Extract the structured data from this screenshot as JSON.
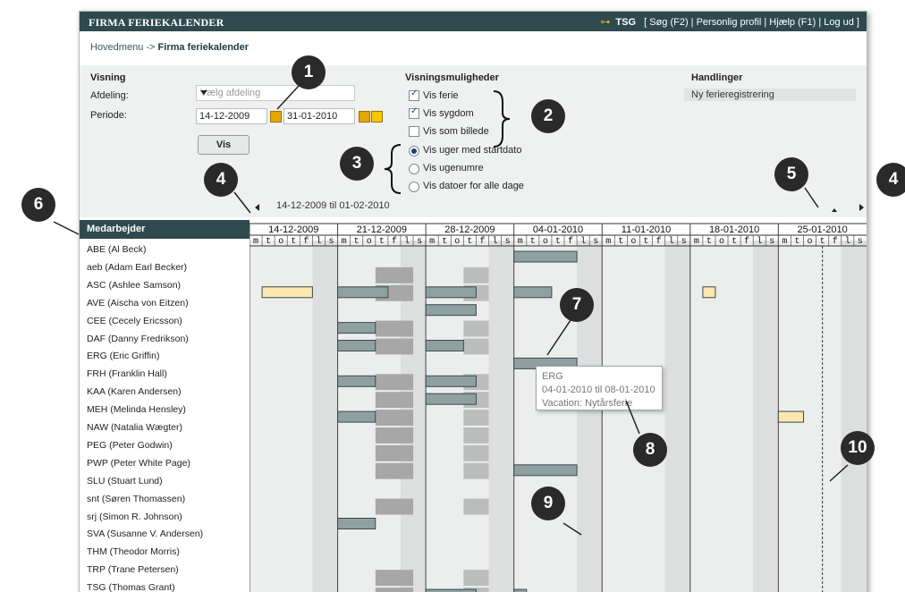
{
  "titlebar": {
    "app_title": "FIRMA FERIEKALENDER",
    "user": "TSG",
    "links": "[ Søg (F2) | Personlig profil | Hjælp (F1) | Log ud ]"
  },
  "breadcrumb": {
    "home": "Hovedmenu",
    "sep": "->",
    "current": "Firma feriekalender"
  },
  "visning": {
    "title": "Visning",
    "afdeling_label": "Afdeling:",
    "afdeling_placeholder": "Vælg afdeling",
    "periode_label": "Periode:",
    "from_date": "14-12-2009",
    "to_date": "31-01-2010",
    "vis_button": "Vis"
  },
  "options": {
    "title": "Visningsmuligheder",
    "checkboxes": [
      {
        "label": "Vis ferie",
        "checked": true
      },
      {
        "label": "Vis sygdom",
        "checked": true
      },
      {
        "label": "Vis som billede",
        "checked": false
      }
    ],
    "radios": [
      {
        "label": "Vis uger med startdato",
        "checked": true
      },
      {
        "label": "Vis ugenumre",
        "checked": false
      },
      {
        "label": "Vis datoer for alle dage",
        "checked": false
      }
    ]
  },
  "actions": {
    "title": "Handlinger",
    "new_label": "Ny ferieregistrering"
  },
  "calendar": {
    "range_text": "14-12-2009 til 01-02-2010",
    "header": "Medarbejder",
    "weeks": [
      "14-12-2009",
      "21-12-2009",
      "28-12-2009",
      "04-01-2010",
      "11-01-2010",
      "18-01-2010",
      "25-01-2010"
    ],
    "day_letters": [
      "m",
      "t",
      "o",
      "t",
      "f",
      "l",
      "s"
    ],
    "employees": [
      "ABE (Al Beck)",
      "aeb (Adam Earl Becker)",
      "ASC (Ashlee Samson)",
      "AVE (Aischa von Eitzen)",
      "CEE (Cecely Ericsson)",
      "DAF (Danny Fredrikson)",
      "ERG (Eric Griffin)",
      "FRH (Franklin Hall)",
      "KAA (Karen Andersen)",
      "MEH (Melinda Hensley)",
      "NAW (Natalia Wægter)",
      "PEG (Peter Godwin)",
      "PWP (Peter White Page)",
      "SLU (Stuart Lund)",
      "snt (Søren Thomassen)",
      "srj (Simon R. Johnson)",
      "SVA (Susanne V. Andersen)",
      "THM (Theodor Morris)",
      "TRP (Trane Petersen)",
      "TSG (Thomas Grant)"
    ],
    "colors": {
      "vacation": "#8fa0a0",
      "sick": "#fde7b0",
      "holiday": "#a7a7a7",
      "weekend": "#dcdcdc"
    }
  },
  "tooltip": {
    "line1": "ERG",
    "line2": "04-01-2010 til 08-01-2010",
    "line3": "Vacation: Nytårsferie"
  },
  "callouts": [
    "1",
    "2",
    "3",
    "4",
    "4",
    "5",
    "6",
    "7",
    "8",
    "9",
    "10"
  ]
}
